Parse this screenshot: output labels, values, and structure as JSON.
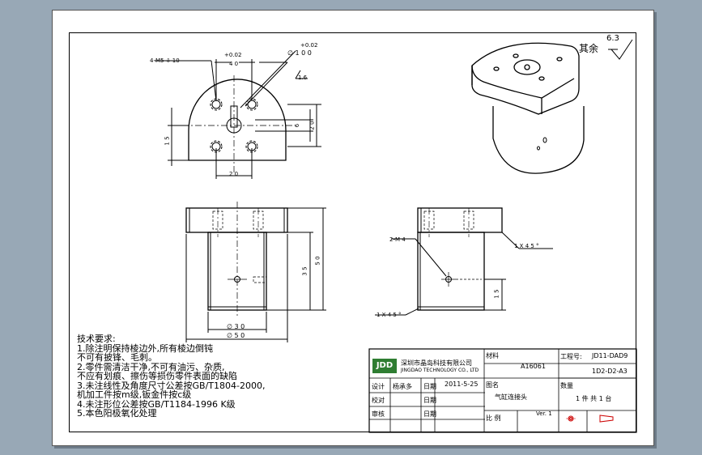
{
  "surface_finish": {
    "label": "其余",
    "value": "6.3"
  },
  "dims_top": {
    "threads": "4-M5 ⇩ 10",
    "tol_a": "+0.02",
    "dim_40": "4 0",
    "tol_b": "+0.02",
    "dia_10": "∅ 1 0   0",
    "ra_16": "1.6",
    "dim_6": "6",
    "dim_20v": "2 0",
    "dim_15": "1 5",
    "dim_20h": "2 0"
  },
  "dims_front": {
    "d30": "∅ 3 0",
    "d50": "∅ 5 0",
    "h35": "3 5",
    "h50": "5 0"
  },
  "dims_side": {
    "m4": "2-M 4",
    "chamfer_top": "1 X 4 5 °",
    "chamfer_bottom": "1 X 4 5 °",
    "h15": "1 5"
  },
  "tech_notes": {
    "title": "技术要求:",
    "lines": [
      "1.除注明保持棱边外,所有棱边倒钝",
      "  不可有披锋、毛刺。",
      "2.零件需清洁干净,不可有油污、杂质,",
      "  不应有划痕、擦伤等损伤零件表面的缺陷",
      "3.未注线性及角度尺寸公差按GB/T1804-2000,",
      "  机加工件按m级,钣金件按c级",
      "4.未注形位公差按GB/T1184-1996 K级",
      "5.本色阳极氧化处理"
    ]
  },
  "title_block": {
    "company_cn": "深圳市晶岛科技有限公司",
    "company_en": "JINGDAO TECHNOLOGY CO., LTD",
    "logo": "JDD",
    "material_label": "材料",
    "material": "A16061",
    "drawing_no_label": "工程号:",
    "drawing_no": "JD11-DAD9",
    "part_no": "1D2-D2-A3",
    "design_label": "设计",
    "designer": "杨承多",
    "date_label1": "日期",
    "date1": "2011-5-25",
    "name_label": "图名",
    "part_name": "气缸连接头",
    "qty_label": "数量",
    "qty_value": "1  件    共  1  台",
    "check_label": "校对",
    "date_label2": "日期",
    "approve_label": "审核",
    "date_label3": "日期",
    "scale_label": "比  例",
    "version": "Ver. 1"
  }
}
